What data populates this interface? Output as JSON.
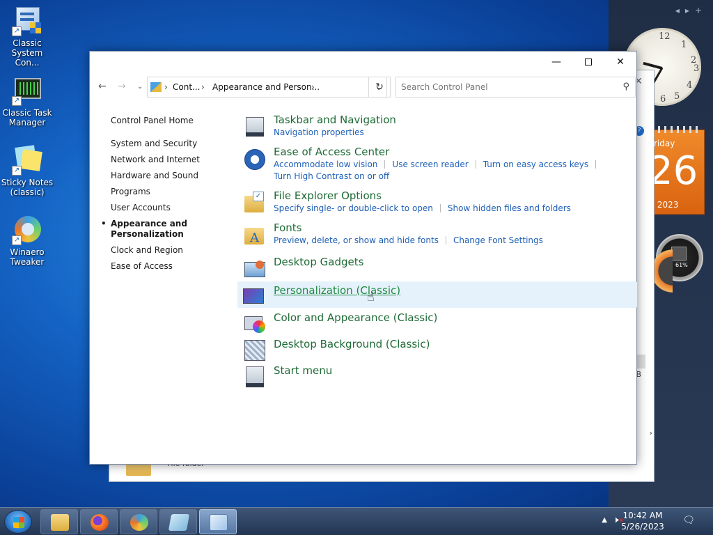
{
  "desktop": {
    "icons": [
      {
        "label": "Classic System Con...",
        "icon": "control-panel-icon"
      },
      {
        "label": "Classic Task Manager",
        "icon": "task-manager-icon"
      },
      {
        "label": "Sticky Notes (classic)",
        "icon": "sticky-notes-icon"
      },
      {
        "label": "Winaero Tweaker",
        "icon": "winaero-tweaker-icon"
      }
    ]
  },
  "gadgets": {
    "calendar": {
      "dow": "riday",
      "day": "26",
      "month_year": "y 2023"
    },
    "meter": {
      "percent": "61%"
    }
  },
  "background_window": {
    "label": "File folder",
    "partial_b": "EB"
  },
  "window": {
    "controls": {
      "minimize": "—",
      "close": "✕"
    },
    "address": {
      "crumb1": "Cont...",
      "crumb2": "Appearance and Person...",
      "sep": "›"
    },
    "search": {
      "placeholder": "Search Control Panel"
    },
    "left_nav": {
      "home": "Control Panel Home",
      "items": [
        "System and Security",
        "Network and Internet",
        "Hardware and Sound",
        "Programs",
        "User Accounts"
      ],
      "active": "Appearance and Personalization",
      "after": [
        "Clock and Region",
        "Ease of Access"
      ]
    },
    "categories": [
      {
        "title": "Taskbar and Navigation",
        "links": [
          "Navigation properties"
        ],
        "icon": "taskbar-icon"
      },
      {
        "title": "Ease of Access Center",
        "links": [
          "Accommodate low vision",
          "Use screen reader",
          "Turn on easy access keys",
          "Turn High Contrast on or off"
        ],
        "icon": "ease-of-access-icon"
      },
      {
        "title": "File Explorer Options",
        "links": [
          "Specify single- or double-click to open",
          "Show hidden files and folders"
        ],
        "icon": "folder-options-icon"
      },
      {
        "title": "Fonts",
        "links": [
          "Preview, delete, or show and hide fonts",
          "Change Font Settings"
        ],
        "icon": "fonts-icon"
      },
      {
        "title": "Desktop Gadgets",
        "links": [],
        "icon": "gadgets-icon"
      },
      {
        "title": "Personalization (Classic)",
        "links": [],
        "icon": "personalization-icon",
        "hovered": true
      },
      {
        "title": "Color and Appearance (Classic)",
        "links": [],
        "icon": "color-appearance-icon"
      },
      {
        "title": "Desktop Background (Classic)",
        "links": [],
        "icon": "desktop-background-icon"
      },
      {
        "title": "Start menu",
        "links": [],
        "icon": "start-menu-icon"
      }
    ]
  },
  "taskbar": {
    "time": "10:42 AM",
    "date": "5/26/2023",
    "apps": [
      "file-explorer",
      "firefox",
      "winaero-tweaker",
      "notes",
      "control-panel"
    ]
  },
  "colors": {
    "category_title": "#1e6b36",
    "link": "#1d5fb6",
    "hover_bg": "#e5f1fb"
  }
}
